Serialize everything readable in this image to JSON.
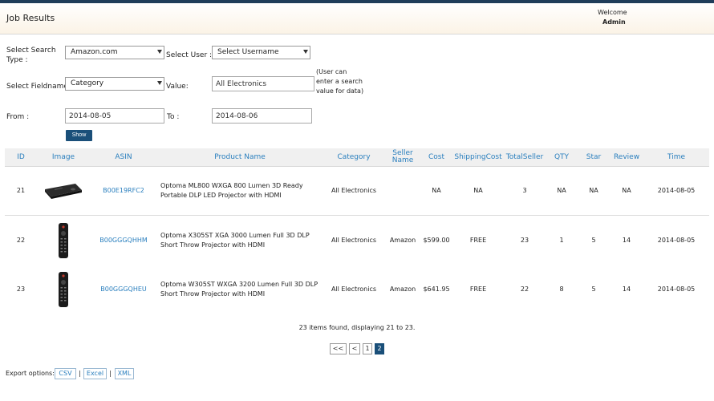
{
  "header": {
    "title": "Job Results",
    "welcome": "Welcome",
    "username": "Admin"
  },
  "form": {
    "search_type_label": "Select Search Type :",
    "search_type_value": "Amazon.com",
    "user_label": "Select User :",
    "user_value": "Select Username",
    "fieldname_label": "Select Fieldname :",
    "fieldname_value": "Category",
    "value_label": "Value:",
    "value_input": "All Electronics",
    "value_note": "(User can enter a search value for data)",
    "from_label": "From :",
    "from_value": "2014-08-05",
    "to_label": "To :",
    "to_value": "2014-08-06",
    "show_label": "Show"
  },
  "table": {
    "headers": {
      "id": "ID",
      "image": "Image",
      "asin": "ASIN",
      "product": "Product Name",
      "category": "Category",
      "seller": "Seller Name",
      "cost": "Cost",
      "shipping": "ShippingCost",
      "totalseller": "TotalSeller",
      "qty": "QTY",
      "star": "Star",
      "review": "Review",
      "time": "Time"
    },
    "rows": [
      {
        "id": "21",
        "image": "projector-image",
        "asin": "B00E19RFC2",
        "product": "Optoma ML800 WXGA 800 Lumen 3D Ready Portable DLP LED Projector with HDMI",
        "category": "All Electronics",
        "seller": "",
        "cost": "NA",
        "shipping": "NA",
        "totalseller": "3",
        "qty": "NA",
        "star": "NA",
        "review": "NA",
        "time": "2014-08-05"
      },
      {
        "id": "22",
        "image": "remote-image",
        "asin": "B00GGGQHHM",
        "product": "Optoma X305ST XGA 3000 Lumen Full 3D DLP Short Throw Projector with HDMI",
        "category": "All Electronics",
        "seller": "Amazon",
        "cost": "$599.00",
        "shipping": "FREE",
        "totalseller": "23",
        "qty": "1",
        "star": "5",
        "review": "14",
        "time": "2014-08-05"
      },
      {
        "id": "23",
        "image": "remote-image",
        "asin": "B00GGGQHEU",
        "product": "Optoma W305ST WXGA 3200 Lumen Full 3D DLP Short Throw Projector with HDMI",
        "category": "All Electronics",
        "seller": "Amazon",
        "cost": "$641.95",
        "shipping": "FREE",
        "totalseller": "22",
        "qty": "8",
        "star": "5",
        "review": "14",
        "time": "2014-08-05"
      }
    ]
  },
  "pager": {
    "info": "23 items found, displaying 21 to 23.",
    "first": "<<",
    "prev": "<",
    "page1": "1",
    "page2": "2"
  },
  "export": {
    "label": "Export options:",
    "csv": "CSV",
    "excel": "Excel",
    "xml": "XML",
    "separator": "|"
  },
  "colors": {
    "accent": "#2a7fbe",
    "button": "#1a4f79",
    "topbar": "#1f3d5a"
  }
}
